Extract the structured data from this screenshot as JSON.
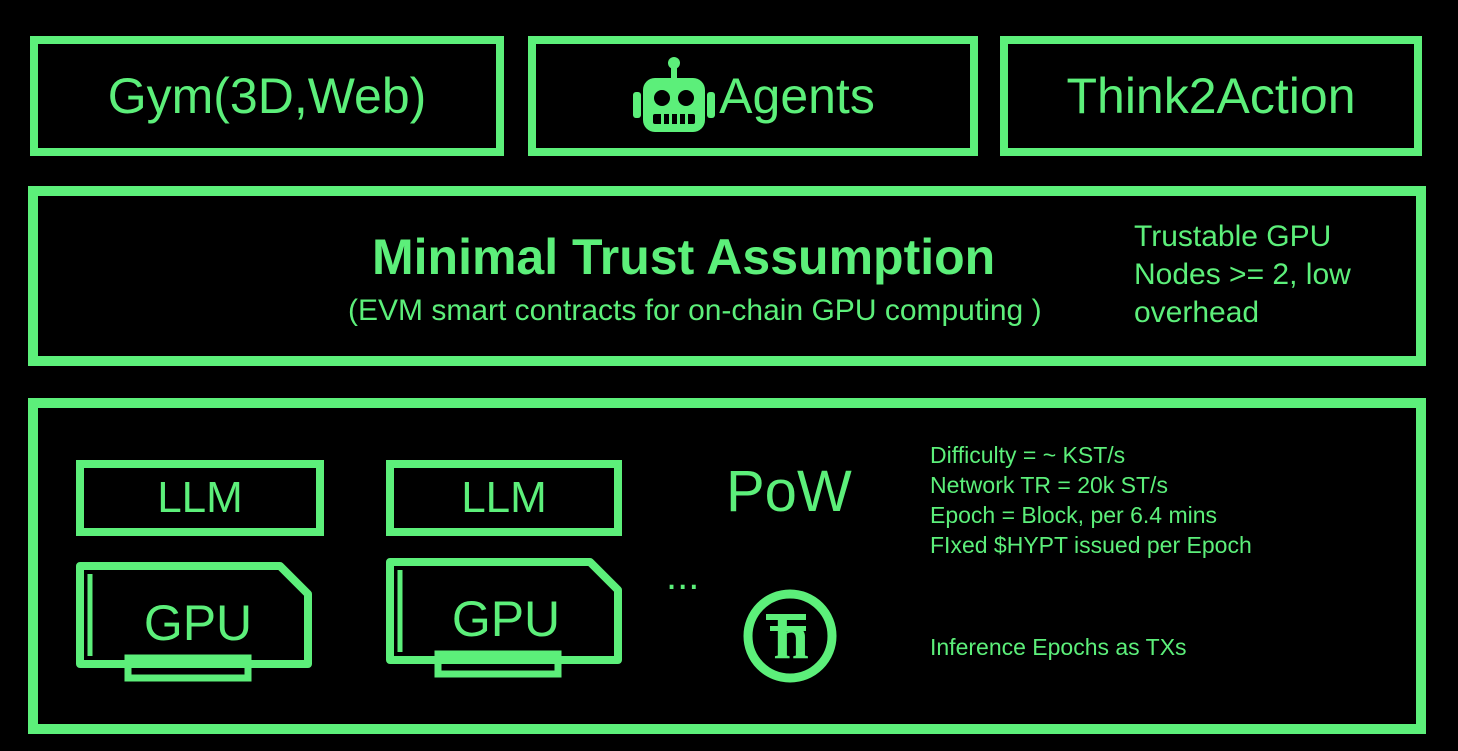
{
  "colors": {
    "accent": "#5cef7a",
    "background": "#000000"
  },
  "top_row": {
    "gym_label": "Gym(3D,Web)",
    "agents_label": "Agents",
    "agents_icon": "robot-icon",
    "think_label": "Think2Action"
  },
  "trust_layer": {
    "title": "Minimal Trust Assumption",
    "subtitle": "(EVM smart contracts for on-chain GPU computing )",
    "side_note_lines": [
      "Trustable GPU",
      "Nodes >= 2, low",
      "overhead"
    ]
  },
  "compute_layer": {
    "nodes": [
      {
        "llm_label": "LLM",
        "gpu_label": "GPU"
      },
      {
        "llm_label": "LLM",
        "gpu_label": "GPU"
      }
    ],
    "ellipsis": "...",
    "pow_label": "PoW",
    "token_icon": "hypt-token-icon",
    "stats_lines": [
      "Difficulty = ~ KST/s",
      "Network TR = 20k ST/s",
      "Epoch = Block, per 6.4 mins",
      "FIxed $HYPT issued per Epoch"
    ],
    "tx_note": "Inference Epochs as TXs"
  }
}
